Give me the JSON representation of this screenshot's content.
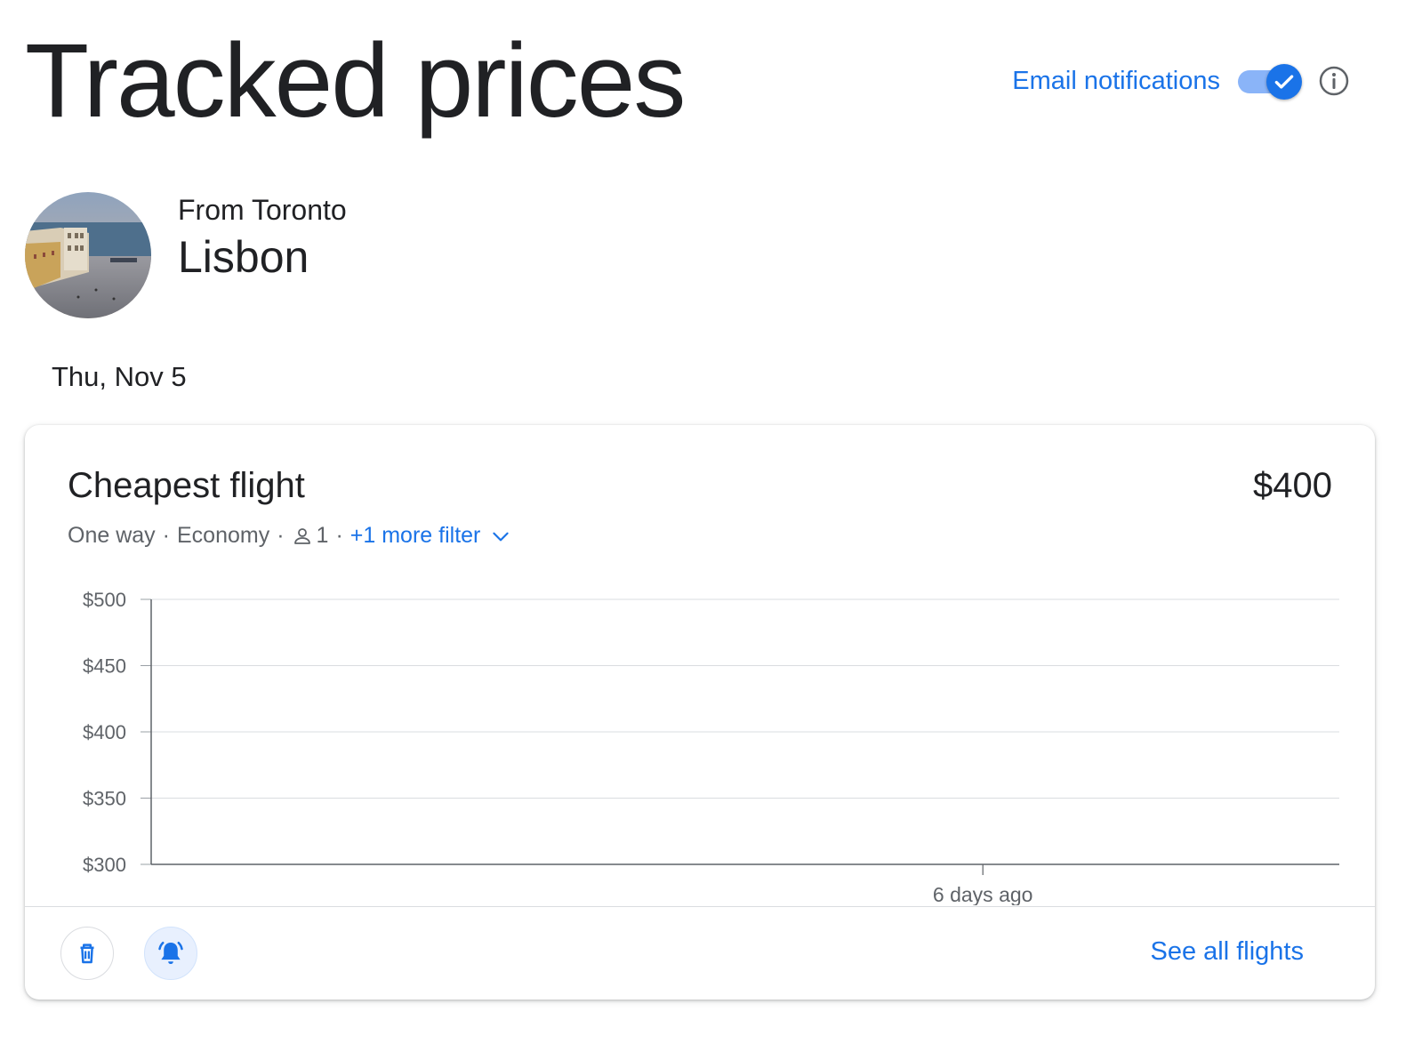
{
  "page": {
    "title": "Tracked prices"
  },
  "notifications": {
    "label": "Email notifications",
    "enabled": true
  },
  "icons": {
    "info": "info-icon",
    "toggle_check": "check-icon",
    "person": "person-icon",
    "chevron": "chevron-down-icon",
    "delete": "trash-icon",
    "alert": "notification-bell-icon"
  },
  "trip": {
    "from_label": "From Toronto",
    "destination": "Lisbon",
    "date": "Thu, Nov 5"
  },
  "card": {
    "title": "Cheapest flight",
    "price": "$400",
    "filters": {
      "trip_type": "One way",
      "cabin": "Economy",
      "passengers": "1",
      "more_filter": "+1 more filter"
    },
    "see_all": "See all flights"
  },
  "colors": {
    "accent": "#1a73e8",
    "toggle_track": "#8ab4f8",
    "alert_bg": "#e8f0fe",
    "text_primary": "#202124",
    "text_secondary": "#5f6368",
    "gridline": "#dadce0"
  },
  "chart_data": {
    "type": "line",
    "title": "",
    "xlabel": "",
    "ylabel": "",
    "ylim": [
      300,
      500
    ],
    "y_ticks": [
      {
        "value": 500,
        "label": "$500"
      },
      {
        "value": 450,
        "label": "$450"
      },
      {
        "value": 400,
        "label": "$400"
      },
      {
        "value": 350,
        "label": "$350"
      },
      {
        "value": 300,
        "label": "$300"
      }
    ],
    "x_ticks": [
      {
        "label": "6 days ago",
        "position": 0.7
      }
    ],
    "grid": true,
    "series": []
  }
}
